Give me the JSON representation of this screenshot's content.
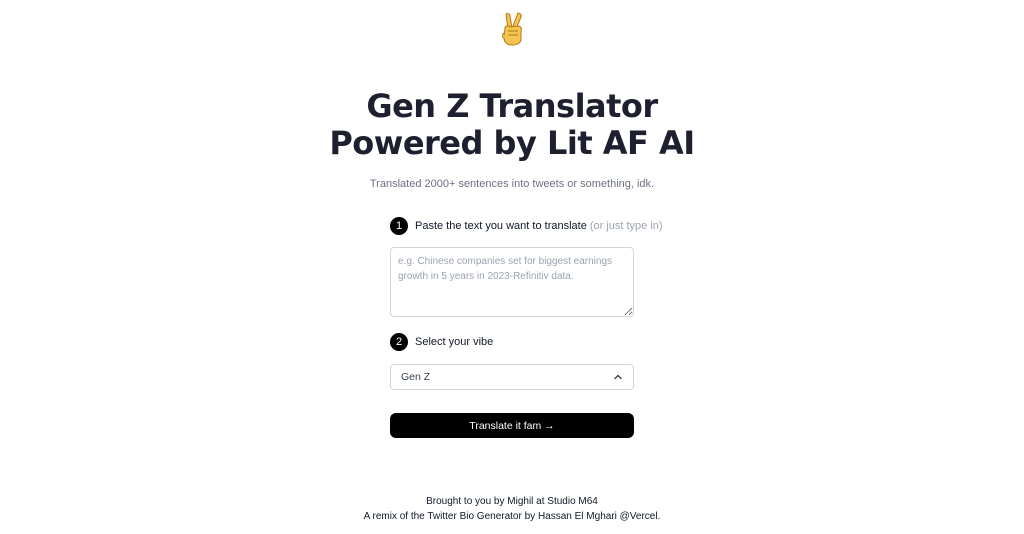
{
  "header": {
    "logo_icon": "victory-hand-icon",
    "title_line1": "Gen Z Translator",
    "title_line2": "Powered by Lit AF AI",
    "subtitle": "Translated 2000+ sentences into tweets or something, idk."
  },
  "steps": [
    {
      "number": "1",
      "label": "Paste the text you want to translate",
      "hint": "(or just type in)"
    },
    {
      "number": "2",
      "label": "Select your vibe"
    }
  ],
  "input": {
    "value": "",
    "placeholder": "e.g. Chinese companies set for biggest earnings growth in 5 years in 2023-Refinitiv data."
  },
  "vibe_select": {
    "selected": "Gen Z",
    "icon": "chevron-up-icon"
  },
  "submit": {
    "label": "Translate it fam →"
  },
  "footer": {
    "line1": "Brought to you by Mighil at Studio M64",
    "line2": "A remix of the Twitter Bio Generator by Hassan El Mghari @Vercel."
  },
  "colors": {
    "accent": "#000000",
    "title": "#1e2030",
    "muted": "#6b7280",
    "border": "#d1d5db"
  }
}
